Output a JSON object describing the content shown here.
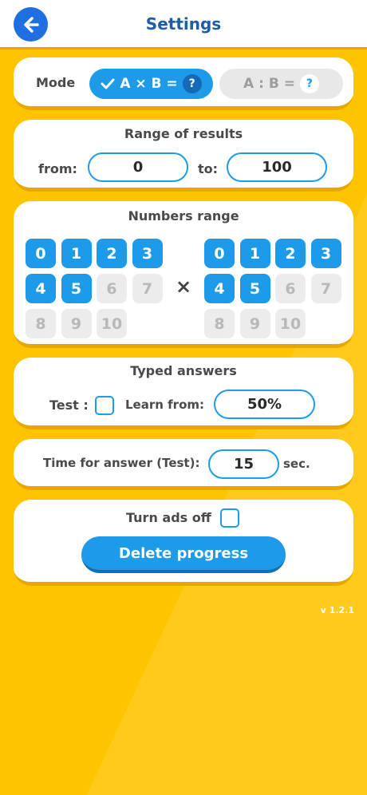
{
  "header": {
    "title": "Settings",
    "back_icon": "arrow-left-icon"
  },
  "mode": {
    "label": "Mode",
    "multiply_label": "A × B =",
    "multiply_badge": "?",
    "divide_label": "A : B =",
    "divide_badge": "?",
    "selected": "multiply"
  },
  "results_range": {
    "title": "Range of results",
    "from_label": "from:",
    "from_value": "0",
    "to_label": "to:",
    "to_value": "100"
  },
  "numbers_range": {
    "title": "Numbers range",
    "times_symbol": "×",
    "left": [
      {
        "n": "0",
        "on": true
      },
      {
        "n": "1",
        "on": true
      },
      {
        "n": "2",
        "on": true
      },
      {
        "n": "3",
        "on": true
      },
      {
        "n": "4",
        "on": true
      },
      {
        "n": "5",
        "on": true
      },
      {
        "n": "6",
        "on": false
      },
      {
        "n": "7",
        "on": false
      },
      {
        "n": "8",
        "on": false
      },
      {
        "n": "9",
        "on": false
      },
      {
        "n": "10",
        "on": false
      }
    ],
    "right": [
      {
        "n": "0",
        "on": true
      },
      {
        "n": "1",
        "on": true
      },
      {
        "n": "2",
        "on": true
      },
      {
        "n": "3",
        "on": true
      },
      {
        "n": "4",
        "on": true
      },
      {
        "n": "5",
        "on": true
      },
      {
        "n": "6",
        "on": false
      },
      {
        "n": "7",
        "on": false
      },
      {
        "n": "8",
        "on": false
      },
      {
        "n": "9",
        "on": false
      },
      {
        "n": "10",
        "on": false
      }
    ]
  },
  "typed_answers": {
    "title": "Typed answers",
    "test_label": "Test :",
    "test_checked": false,
    "learn_label": "Learn from:",
    "learn_value": "50%"
  },
  "time": {
    "label": "Time for answer (Test):",
    "value": "15",
    "unit": "sec."
  },
  "ads": {
    "label": "Turn ads off",
    "checked": false,
    "delete_label": "Delete progress"
  },
  "version": "v 1.2.1",
  "colors": {
    "background": "#ffc400",
    "accent": "#1e9be8",
    "title": "#1d5ca8",
    "back_button": "#1f6fe0"
  }
}
